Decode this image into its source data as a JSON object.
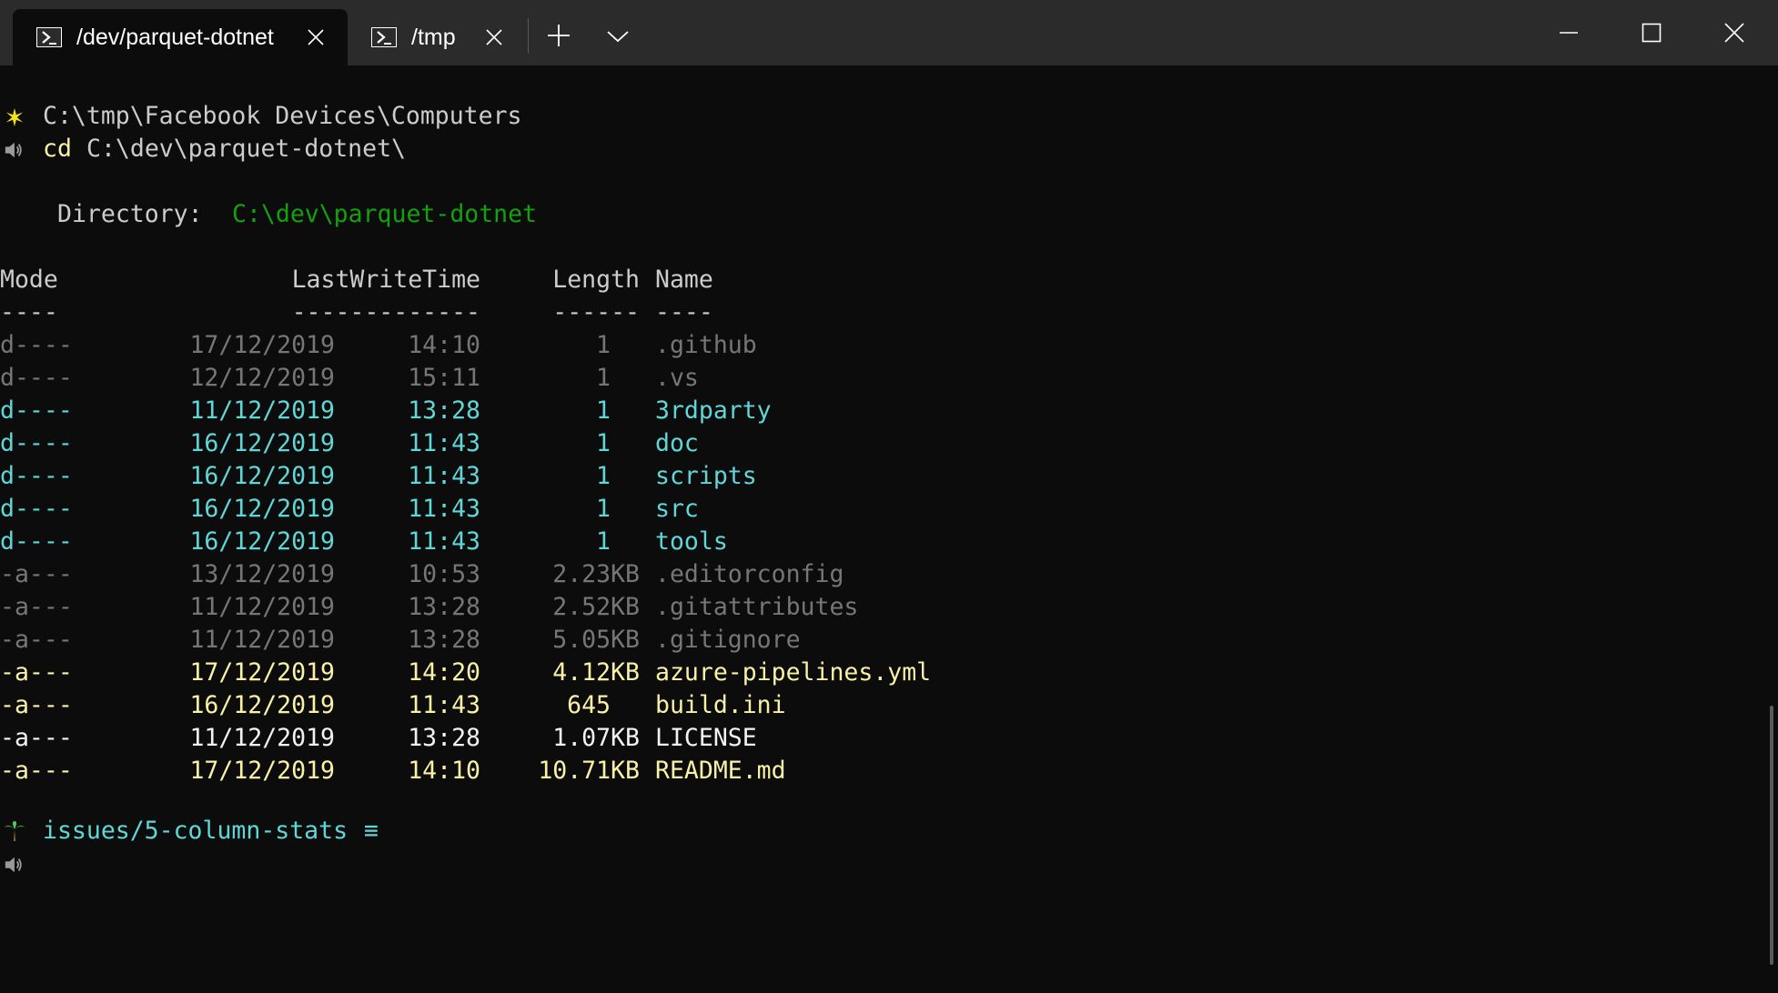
{
  "tabs": [
    {
      "label": "/dev/parquet-dotnet",
      "active": true
    },
    {
      "label": "/tmp",
      "active": false
    }
  ],
  "colors": {
    "background": "#0c0c0c",
    "titlebar": "#2b2b2b",
    "text": "#cccccc",
    "bright_white": "#f2f2f2",
    "green": "#13a10e",
    "cyan": "#61d6d6",
    "gray": "#767676",
    "yellow": "#f9f1a5",
    "prompt_cmd": "#f9f1a5"
  },
  "terminal": {
    "prompt1_icon": "sun-icon",
    "prompt1_path": "C:\\tmp\\Facebook Devices\\Computers",
    "prompt1_cmd_icon": "speaker-icon",
    "command": "cd",
    "command_arg": "C:\\dev\\parquet-dotnet\\",
    "directory_label": "Directory:",
    "directory_path": "C:\\dev\\parquet-dotnet",
    "headers": {
      "mode": "Mode",
      "lastwrite": "LastWriteTime",
      "length": "Length",
      "name": "Name"
    },
    "underlines": {
      "mode": "----",
      "lastwrite": "-------------",
      "length": "------",
      "name": "----"
    },
    "rows": [
      {
        "mode": "d----",
        "date": "17/12/2019",
        "time": "14:10",
        "length": "1",
        "name": ".github",
        "color": "#767676"
      },
      {
        "mode": "d----",
        "date": "12/12/2019",
        "time": "15:11",
        "length": "1",
        "name": ".vs",
        "color": "#767676"
      },
      {
        "mode": "d----",
        "date": "11/12/2019",
        "time": "13:28",
        "length": "1",
        "name": "3rdparty",
        "color": "#61d6d6"
      },
      {
        "mode": "d----",
        "date": "16/12/2019",
        "time": "11:43",
        "length": "1",
        "name": "doc",
        "color": "#61d6d6"
      },
      {
        "mode": "d----",
        "date": "16/12/2019",
        "time": "11:43",
        "length": "1",
        "name": "scripts",
        "color": "#61d6d6"
      },
      {
        "mode": "d----",
        "date": "16/12/2019",
        "time": "11:43",
        "length": "1",
        "name": "src",
        "color": "#61d6d6"
      },
      {
        "mode": "d----",
        "date": "16/12/2019",
        "time": "11:43",
        "length": "1",
        "name": "tools",
        "color": "#61d6d6"
      },
      {
        "mode": "-a---",
        "date": "13/12/2019",
        "time": "10:53",
        "length": "2.23KB",
        "name": ".editorconfig",
        "color": "#767676"
      },
      {
        "mode": "-a---",
        "date": "11/12/2019",
        "time": "13:28",
        "length": "2.52KB",
        "name": ".gitattributes",
        "color": "#767676"
      },
      {
        "mode": "-a---",
        "date": "11/12/2019",
        "time": "13:28",
        "length": "5.05KB",
        "name": ".gitignore",
        "color": "#767676"
      },
      {
        "mode": "-a---",
        "date": "17/12/2019",
        "time": "14:20",
        "length": "4.12KB",
        "name": "azure-pipelines.yml",
        "color": "#f9f1a5"
      },
      {
        "mode": "-a---",
        "date": "16/12/2019",
        "time": "11:43",
        "length": "645",
        "name": "build.ini",
        "color": "#f9f1a5"
      },
      {
        "mode": "-a---",
        "date": "11/12/2019",
        "time": "13:28",
        "length": "1.07KB",
        "name": "LICENSE",
        "color": "#f2f2f2"
      },
      {
        "mode": "-a---",
        "date": "17/12/2019",
        "time": "14:10",
        "length": "10.71KB",
        "name": "README.md",
        "color": "#f9f1a5"
      }
    ],
    "prompt2_icon": "palm-tree-icon",
    "branch": "issues/5-column-stats",
    "branch_status": "≡",
    "prompt2_cmd_icon": "speaker-icon"
  }
}
